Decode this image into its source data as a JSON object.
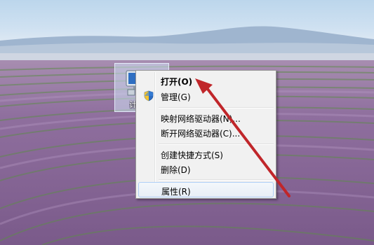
{
  "desktop": {
    "icon": {
      "name": "computer-icon",
      "label": "计"
    }
  },
  "context_menu": {
    "items": [
      {
        "label": "打开(O)",
        "bold": true
      },
      {
        "label": "管理(G)",
        "icon": "uac-shield-icon"
      },
      {
        "label": "映射网络驱动器(N)..."
      },
      {
        "label": "断开网络驱动器(C)..."
      },
      {
        "label": "创建快捷方式(S)"
      },
      {
        "label": "删除(D)"
      },
      {
        "label": "属性(R)",
        "highlighted": true
      }
    ]
  },
  "annotation": {
    "type": "arrow",
    "color": "#c0262a",
    "points_to": "打开(O)"
  },
  "colors": {
    "menu_bg": "#f1f1f1",
    "menu_border": "#979797",
    "highlight_border": "#aecff7"
  }
}
